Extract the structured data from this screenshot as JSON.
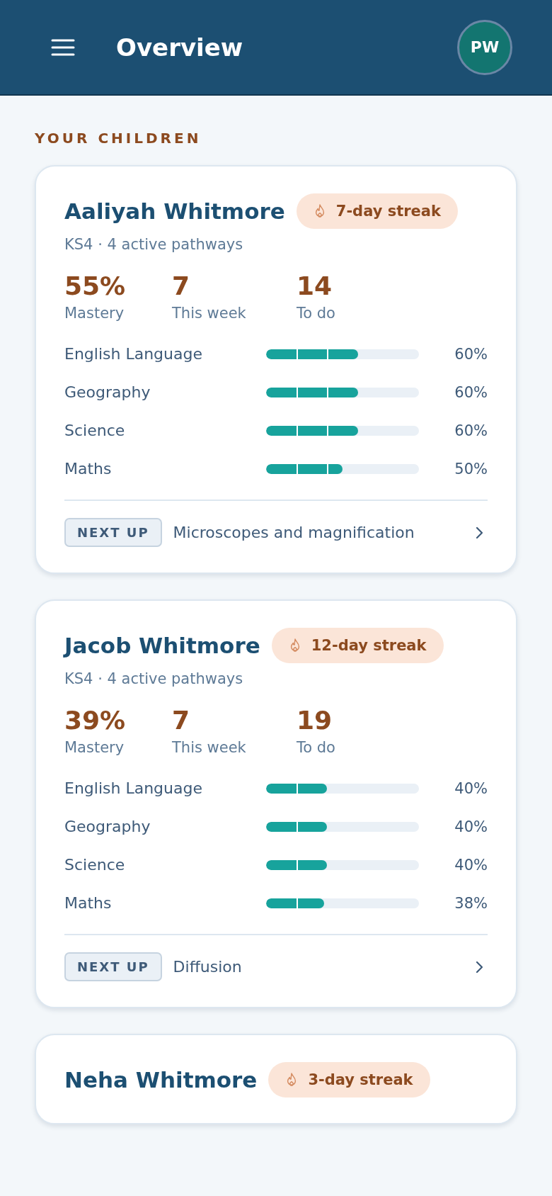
{
  "header": {
    "title": "Overview",
    "avatar_initials": "PW"
  },
  "section_title": "YOUR CHILDREN",
  "children": [
    {
      "name": "Aaliyah Whitmore",
      "streak": "7-day streak",
      "meta": "KS4 · 4 active pathways",
      "stats": [
        {
          "value": "55%",
          "label": "Mastery"
        },
        {
          "value": "7",
          "label": "This week"
        },
        {
          "value": "14",
          "label": "To do"
        }
      ],
      "subjects": [
        {
          "name": "English Language",
          "level": 0.6,
          "reading": "60%"
        },
        {
          "name": "Geography",
          "level": 0.6,
          "reading": "60%"
        },
        {
          "name": "Science",
          "level": 0.6,
          "reading": "60%"
        },
        {
          "name": "Maths",
          "level": 0.5,
          "reading": "50%"
        }
      ],
      "next_up": {
        "tag": "NEXT UP",
        "title": "Microscopes and magnification"
      }
    },
    {
      "name": "Jacob Whitmore",
      "streak": "12-day streak",
      "meta": "KS4 · 4 active pathways",
      "stats": [
        {
          "value": "39%",
          "label": "Mastery"
        },
        {
          "value": "7",
          "label": "This week"
        },
        {
          "value": "19",
          "label": "To do"
        }
      ],
      "subjects": [
        {
          "name": "English Language",
          "level": 0.4,
          "reading": "40%"
        },
        {
          "name": "Geography",
          "level": 0.4,
          "reading": "40%"
        },
        {
          "name": "Science",
          "level": 0.4,
          "reading": "40%"
        },
        {
          "name": "Maths",
          "level": 0.38,
          "reading": "38%"
        }
      ],
      "next_up": {
        "tag": "NEXT UP",
        "title": "Diffusion"
      }
    },
    {
      "name": "Neha Whitmore",
      "streak": "3-day streak"
    }
  ]
}
